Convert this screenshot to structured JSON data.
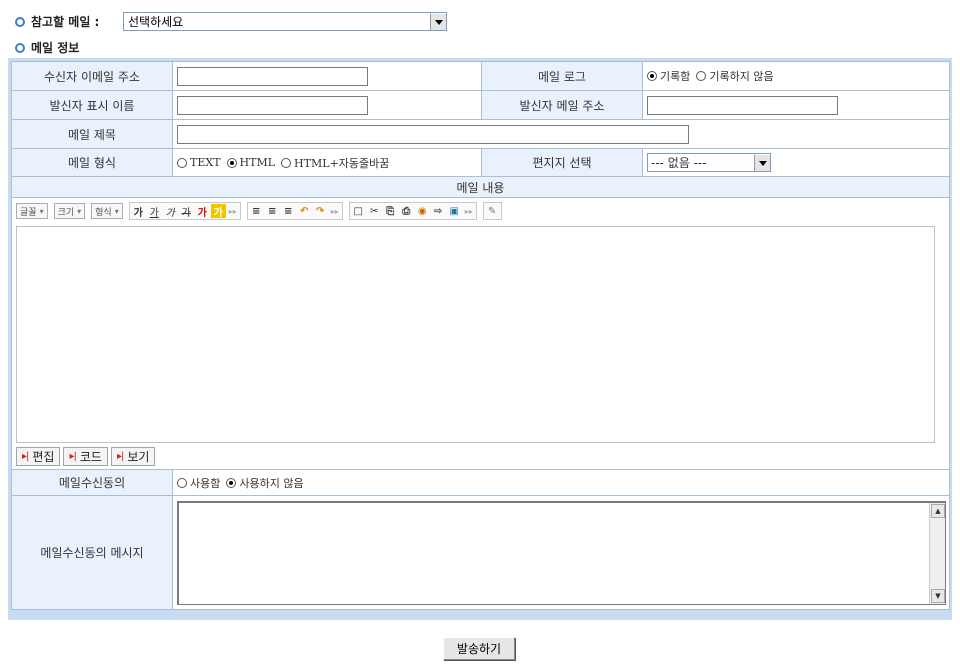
{
  "ref_mail": {
    "label": "참고할 메일 :",
    "selected": "선택하세요"
  },
  "mail_info": {
    "label": "메일 정보"
  },
  "form": {
    "recipient_label": "수신자 이메일 주소",
    "recipient_value": "",
    "log_label": "메일 로그",
    "log_options": [
      "기록함",
      "기록하지 않음"
    ],
    "log_selected": 0,
    "sender_name_label": "발신자 표시 이름",
    "sender_name_value": "",
    "sender_email_label": "발신자 메일 주소",
    "sender_email_value": "",
    "subject_label": "메일 제목",
    "subject_value": "",
    "format_label": "메일 형식",
    "format_options": [
      "TEXT",
      "HTML",
      "HTML+자동줄바꿈"
    ],
    "format_selected": 1,
    "editor_label": "편지지 선택",
    "editor_selected": "--- 없음 ---",
    "content_label": "메일 내용",
    "consent_label": "메일수신동의",
    "consent_options": [
      "사용함",
      "사용하지 않음"
    ],
    "consent_selected": 1,
    "consent_msg_label": "메일수신동의 메시지",
    "consent_msg_value": ""
  },
  "toolbar": {
    "combos": [
      "글꼴",
      "크기",
      "형식"
    ],
    "text_buttons": [
      "가",
      "가",
      "가",
      "가",
      "가",
      "가"
    ],
    "align_buttons": [
      "≡",
      "≡",
      "≡",
      "↶",
      "↷"
    ],
    "insert_buttons": [
      "□",
      "✂",
      "⎘",
      "⎙",
      "◉",
      "⇨",
      "▣"
    ],
    "extra_buttons": [
      "✎"
    ]
  },
  "modes": [
    "편집",
    "코드",
    "보기"
  ],
  "send_label": "발송하기"
}
